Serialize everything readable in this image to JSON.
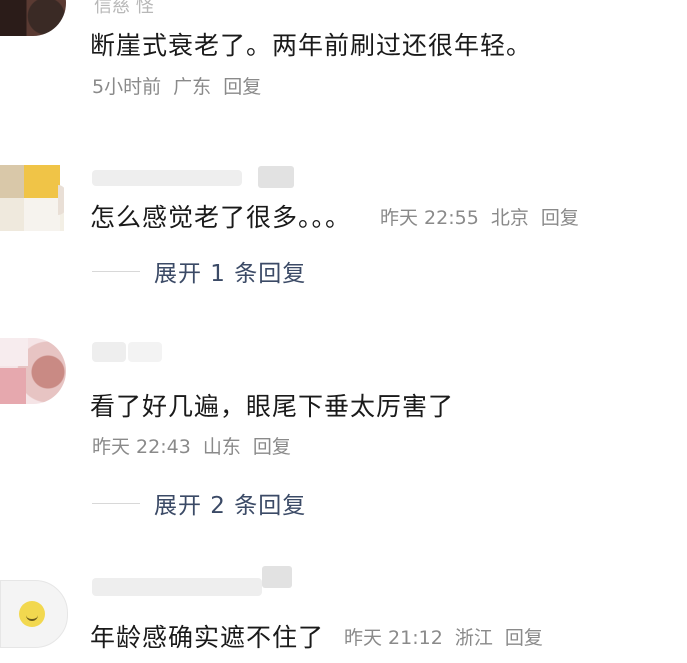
{
  "comments": [
    {
      "partial_name": "‍信慈 怪",
      "text": "断崖式衰老了。两年前刷过还很年轻。",
      "time": "5小时前",
      "location": "广东",
      "reply_label": "回复"
    },
    {
      "text": "怎么感觉老了很多。。。",
      "time": "昨天 22:55",
      "location": "北京",
      "reply_label": "回复",
      "expand_label": "展开 1 条回复"
    },
    {
      "text": "看了好几遍，眼尾下垂太厉害了",
      "time": "昨天 22:43",
      "location": "山东",
      "reply_label": "回复",
      "expand_label": "展开 2 条回复"
    },
    {
      "text": "年龄感确实遮不住了",
      "time": "昨天 21:12",
      "location": "浙江",
      "reply_label": "回复"
    }
  ],
  "icons": {
    "avatar": "user-avatar-icon",
    "emoji": "smiley-face-icon"
  },
  "colors": {
    "comment_text": "#1a1a1a",
    "meta_text": "#8a8a8a",
    "expand_text": "#3b4a66",
    "divider": "#d8d8d8"
  }
}
